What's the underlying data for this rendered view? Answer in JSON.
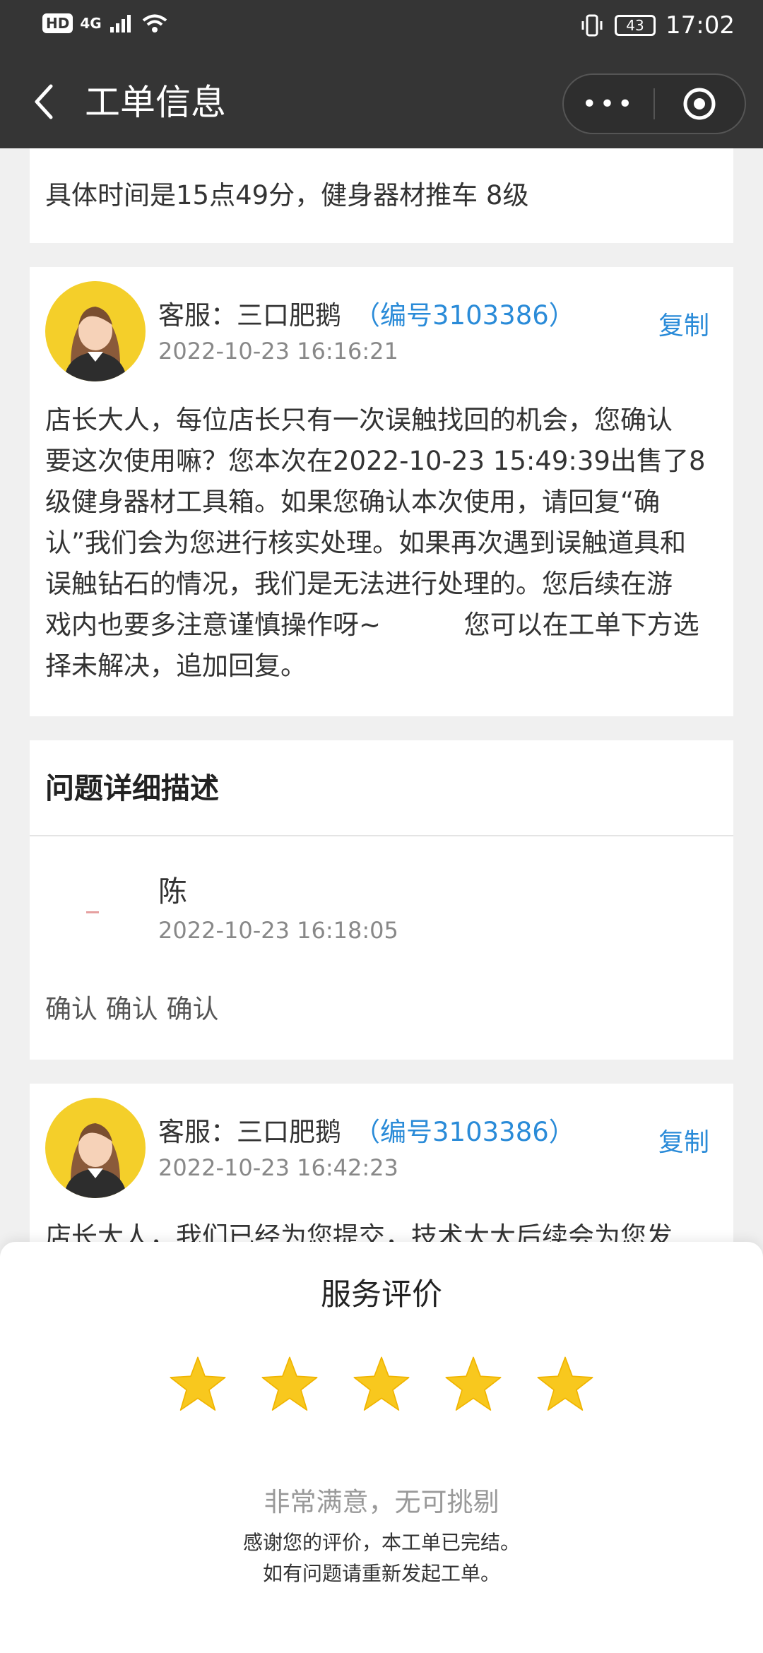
{
  "status_bar": {
    "hd": "HD",
    "network": "4G",
    "battery": "43",
    "time": "17:02"
  },
  "header": {
    "title": "工单信息",
    "more_label": "•••"
  },
  "messages": {
    "first_fragment": "具体时间是15点49分，健身器材推车 8级",
    "reply1": {
      "name": "客服：三口肥鹅",
      "id": "（编号3103386）",
      "time": "2022-10-23 16:16:21",
      "copy": "复制",
      "lines": [
        "店长大人，每位店长只有一次误触找回的机会，您确认",
        "要这次使用嘛？您本次在2022-10-23 15:49:39出售了8",
        "级健身器材工具箱。如果您确认本次使用，请回复“确",
        "认”我们会为您进行核实处理。如果再次遇到误触道具和",
        "误触钻石的情况，我们是无法进行处理的。您后续在游",
        "戏内也要多注意谨慎操作呀~          您可以在工单下方选",
        "择未解决，追加回复。"
      ]
    },
    "detail": {
      "section_title": "问题详细描述",
      "user_name": "陈",
      "time": "2022-10-23 16:18:05",
      "text": "确认 确认 确认"
    },
    "reply2": {
      "name": "客服：三口肥鹅",
      "id": "（编号3103386）",
      "time": "2022-10-23 16:42:23",
      "copy": "复制",
      "partial": "店长大人，我们已经为您提交，技术大大后续会为您发"
    }
  },
  "rating_sheet": {
    "title": "服务评价",
    "stars": 5,
    "stars_max": 5,
    "star_color": "#f8c81e",
    "rating_text": "非常满意，无可挑剔",
    "note_line1": "感谢您的评价，本工单已完结。",
    "note_line2": "如有问题请重新发起工单。"
  },
  "colors": {
    "header_bg": "#353535",
    "accent": "#2a8bd8",
    "avatar_bg": "#f4cf2a"
  }
}
